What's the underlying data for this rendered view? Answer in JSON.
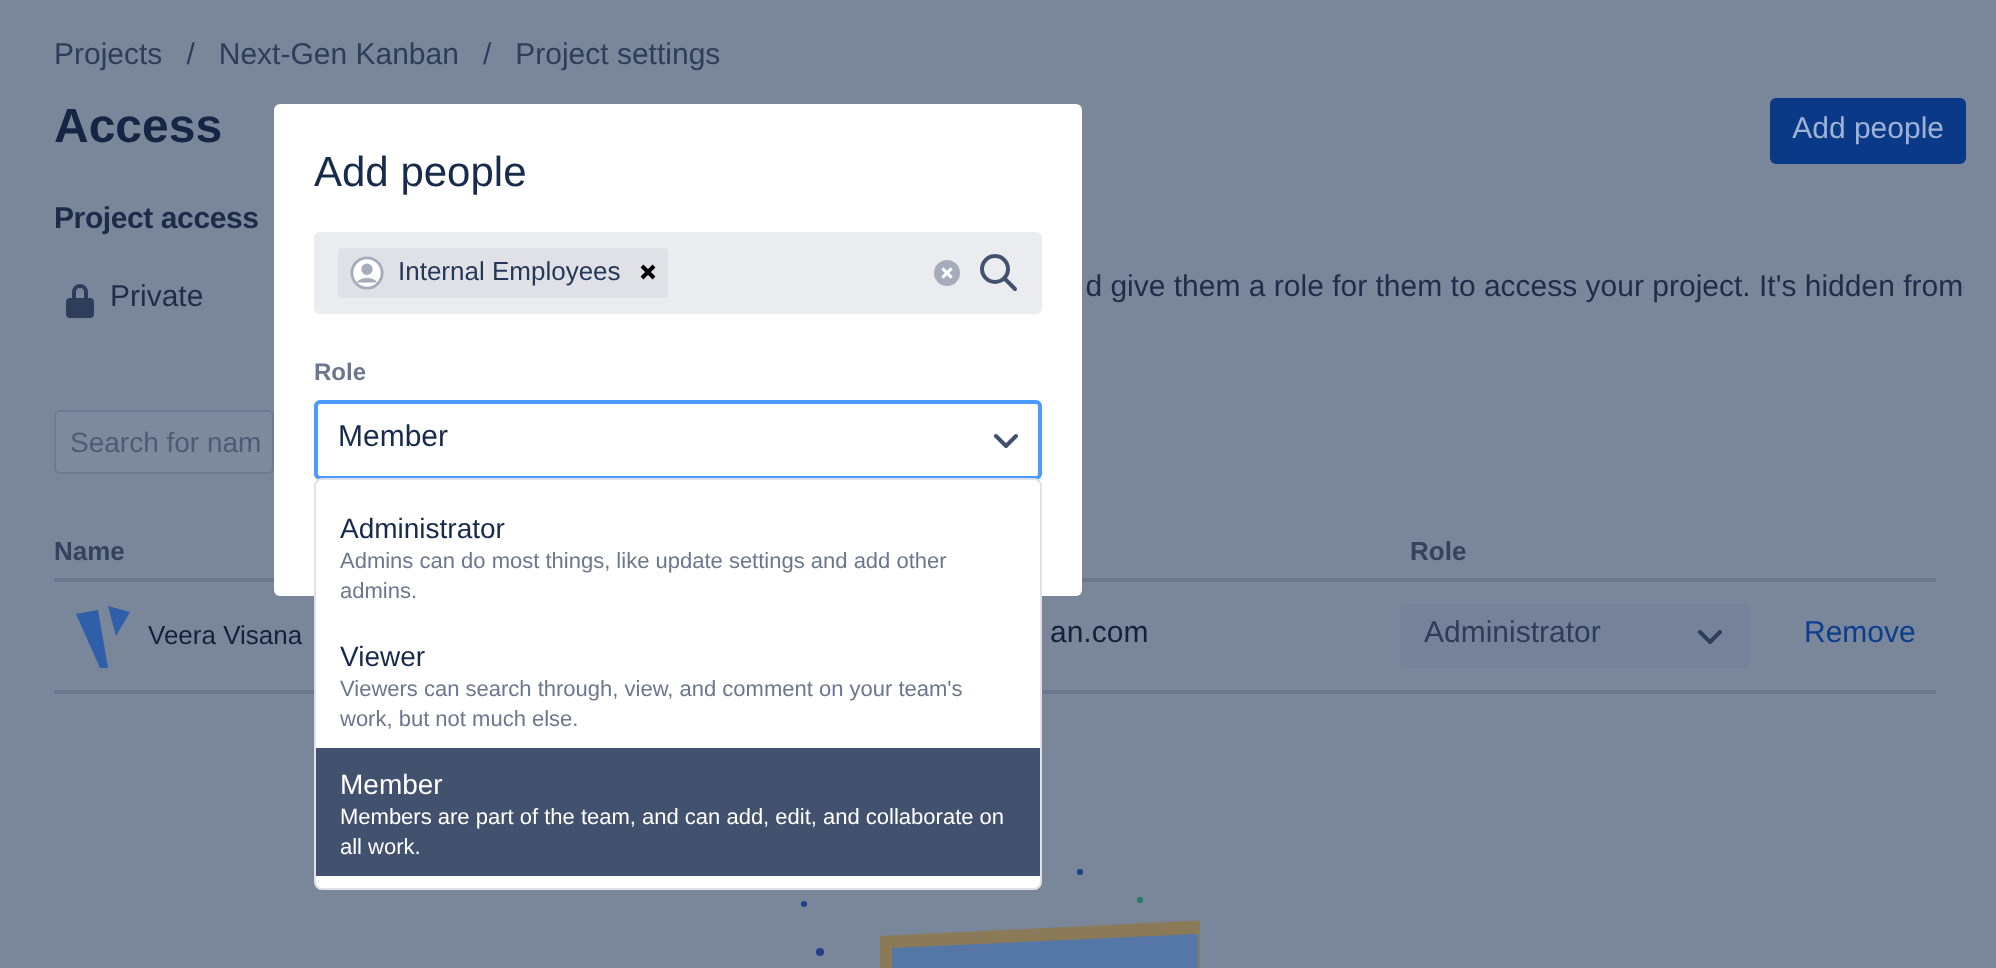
{
  "breadcrumbs": {
    "separator": "/",
    "items": [
      "Projects",
      "Next-Gen Kanban",
      "Project settings"
    ]
  },
  "page": {
    "title": "Access",
    "add_button": "Add people"
  },
  "project_access": {
    "heading": "Project access",
    "visibility": "Private",
    "description": "d give them a role for them to access your project. It's hidden from"
  },
  "search": {
    "placeholder": "Search for nam"
  },
  "table": {
    "columns": [
      "Name",
      "Role"
    ],
    "rows": [
      {
        "name": "Veera Visana",
        "email": "an.com",
        "role": "Administrator",
        "action": "Remove"
      }
    ]
  },
  "modal": {
    "title": "Add people",
    "chips": [
      {
        "label": "Internal Employees"
      }
    ],
    "role_label": "Role",
    "role_value": "Member",
    "options": [
      {
        "label": "Administrator",
        "description": "Admins can do most things, like update settings and add other admins.",
        "selected": false
      },
      {
        "label": "Viewer",
        "description": "Viewers can search through, view, and comment on your team's work, but not much else.",
        "selected": false
      },
      {
        "label": "Member",
        "description": "Members are part of the team, and can add, edit, and collaborate on all work.",
        "selected": true
      }
    ]
  }
}
